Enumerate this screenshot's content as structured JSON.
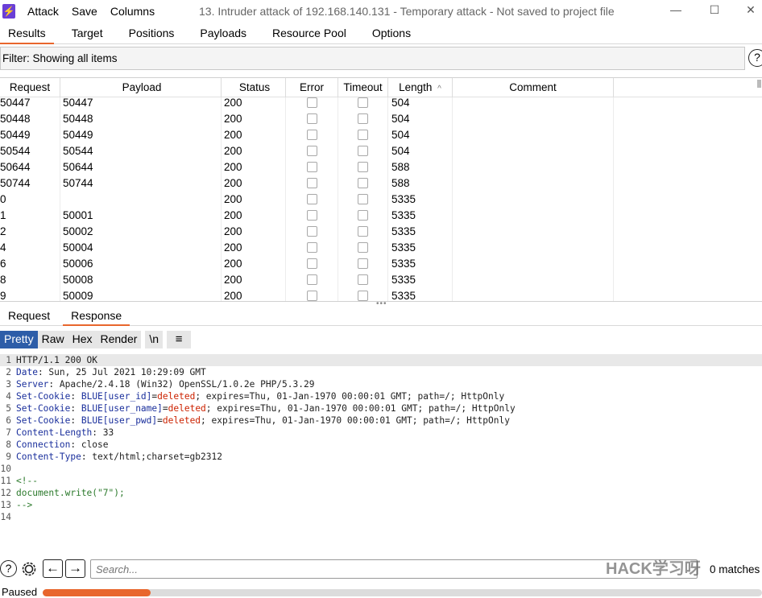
{
  "menu": {
    "items": [
      "Attack",
      "Save",
      "Columns"
    ]
  },
  "window": {
    "title": "13. Intruder attack of 192.168.140.131 - Temporary attack - Not saved to project file",
    "minimize": "—",
    "maximize": "☐",
    "close": "✕"
  },
  "tabs": [
    "Results",
    "Target",
    "Positions",
    "Payloads",
    "Resource Pool",
    "Options"
  ],
  "filter": {
    "text": "Filter: Showing all items",
    "help": "?"
  },
  "table": {
    "headers": [
      "Request",
      "Payload",
      "Status",
      "Error",
      "Timeout",
      "Length",
      "Comment"
    ],
    "sort_indicator": "^",
    "rows": [
      {
        "request": "50447",
        "payload": "50447",
        "status": "200",
        "length": "504"
      },
      {
        "request": "50448",
        "payload": "50448",
        "status": "200",
        "length": "504"
      },
      {
        "request": "50449",
        "payload": "50449",
        "status": "200",
        "length": "504"
      },
      {
        "request": "50544",
        "payload": "50544",
        "status": "200",
        "length": "504"
      },
      {
        "request": "50644",
        "payload": "50644",
        "status": "200",
        "length": "588"
      },
      {
        "request": "50744",
        "payload": "50744",
        "status": "200",
        "length": "588"
      },
      {
        "request": "0",
        "payload": "",
        "status": "200",
        "length": "5335"
      },
      {
        "request": "1",
        "payload": "50001",
        "status": "200",
        "length": "5335"
      },
      {
        "request": "2",
        "payload": "50002",
        "status": "200",
        "length": "5335"
      },
      {
        "request": "4",
        "payload": "50004",
        "status": "200",
        "length": "5335"
      },
      {
        "request": "6",
        "payload": "50006",
        "status": "200",
        "length": "5335"
      },
      {
        "request": "8",
        "payload": "50008",
        "status": "200",
        "length": "5335"
      },
      {
        "request": "9",
        "payload": "50009",
        "status": "200",
        "length": "5335"
      }
    ]
  },
  "rr_tabs": [
    "Request",
    "Response"
  ],
  "view_buttons": [
    "Pretty",
    "Raw",
    "Hex",
    "Render",
    "\\n",
    "≡"
  ],
  "response": {
    "lines": [
      {
        "n": "1",
        "parts": [
          {
            "c": "k-val",
            "t": "HTTP/1.1 200 OK"
          }
        ]
      },
      {
        "n": "2",
        "parts": [
          {
            "c": "k-hdr",
            "t": "Date"
          },
          {
            "c": "k-val",
            "t": ": Sun, 25 Jul 2021 10:29:09 GMT"
          }
        ]
      },
      {
        "n": "3",
        "parts": [
          {
            "c": "k-hdr",
            "t": "Server"
          },
          {
            "c": "k-val",
            "t": ": Apache/2.4.18 (Win32) OpenSSL/1.0.2e PHP/5.3.29"
          }
        ]
      },
      {
        "n": "4",
        "parts": [
          {
            "c": "k-hdr",
            "t": "Set-Cookie"
          },
          {
            "c": "k-val",
            "t": ": "
          },
          {
            "c": "k-hdr",
            "t": "BLUE[user_id]"
          },
          {
            "c": "k-val",
            "t": "="
          },
          {
            "c": "k-red",
            "t": "deleted"
          },
          {
            "c": "k-val",
            "t": "; expires=Thu, 01-Jan-1970 00:00:01 GMT; path=/; HttpOnly"
          }
        ]
      },
      {
        "n": "5",
        "parts": [
          {
            "c": "k-hdr",
            "t": "Set-Cookie"
          },
          {
            "c": "k-val",
            "t": ": "
          },
          {
            "c": "k-hdr",
            "t": "BLUE[user_name]"
          },
          {
            "c": "k-val",
            "t": "="
          },
          {
            "c": "k-red",
            "t": "deleted"
          },
          {
            "c": "k-val",
            "t": "; expires=Thu, 01-Jan-1970 00:00:01 GMT; path=/; HttpOnly"
          }
        ]
      },
      {
        "n": "6",
        "parts": [
          {
            "c": "k-hdr",
            "t": "Set-Cookie"
          },
          {
            "c": "k-val",
            "t": ": "
          },
          {
            "c": "k-hdr",
            "t": "BLUE[user_pwd]"
          },
          {
            "c": "k-val",
            "t": "="
          },
          {
            "c": "k-red",
            "t": "deleted"
          },
          {
            "c": "k-val",
            "t": "; expires=Thu, 01-Jan-1970 00:00:01 GMT; path=/; HttpOnly"
          }
        ]
      },
      {
        "n": "7",
        "parts": [
          {
            "c": "k-hdr",
            "t": "Content-Length"
          },
          {
            "c": "k-val",
            "t": ": 33"
          }
        ]
      },
      {
        "n": "8",
        "parts": [
          {
            "c": "k-hdr",
            "t": "Connection"
          },
          {
            "c": "k-val",
            "t": ": close"
          }
        ]
      },
      {
        "n": "9",
        "parts": [
          {
            "c": "k-hdr",
            "t": "Content-Type"
          },
          {
            "c": "k-val",
            "t": ": text/html;charset=gb2312"
          }
        ]
      },
      {
        "n": "10",
        "parts": []
      },
      {
        "n": "11",
        "parts": [
          {
            "c": "k-grn",
            "t": "<!--"
          }
        ]
      },
      {
        "n": "12",
        "parts": [
          {
            "c": "k-grn",
            "t": "document.write(\"7\");"
          }
        ]
      },
      {
        "n": "13",
        "parts": [
          {
            "c": "k-grn",
            "t": "-->"
          }
        ]
      },
      {
        "n": "14",
        "parts": []
      }
    ]
  },
  "bottom": {
    "help": "?",
    "settings_icon": "gear-icon",
    "back": "←",
    "forward": "→",
    "search_placeholder": "Search...",
    "matches": "0 matches",
    "watermark": "HACK学习呀"
  },
  "status": {
    "text": "Paused",
    "progress_fraction": 0.15
  }
}
